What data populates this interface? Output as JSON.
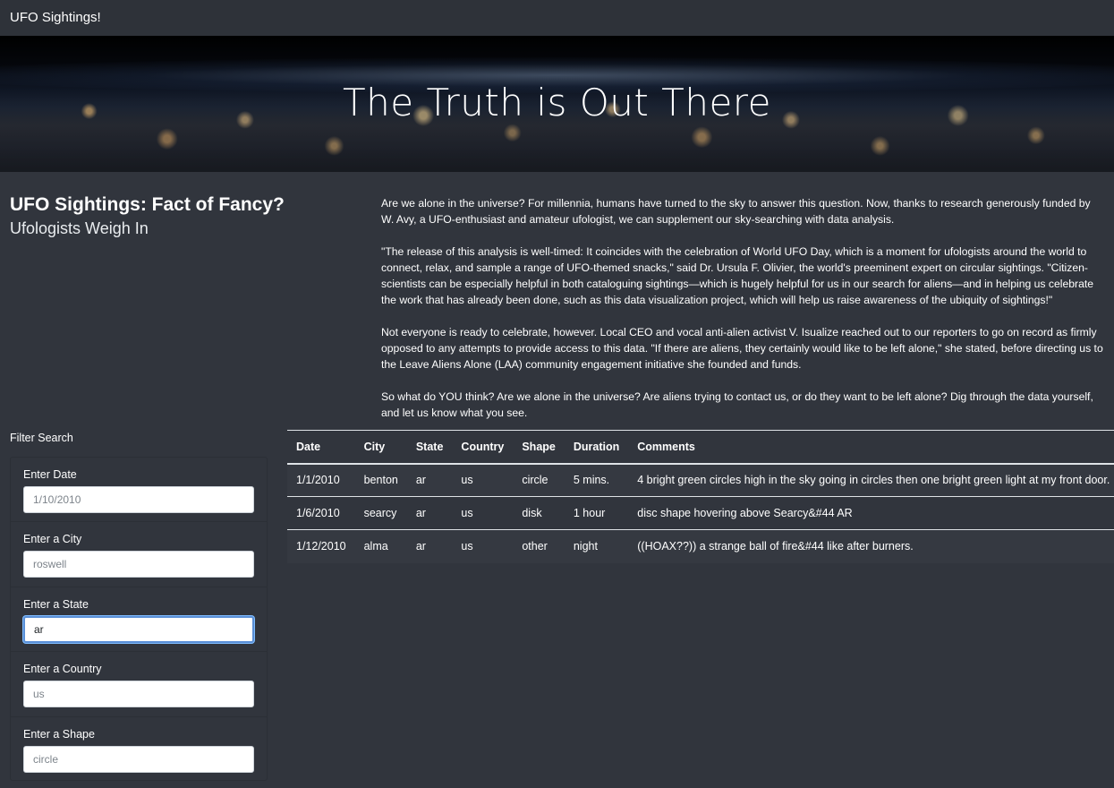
{
  "navbar": {
    "brand": "UFO Sightings!"
  },
  "hero": {
    "title": "The Truth is Out There"
  },
  "article": {
    "headline_strong": "UFO Sightings: Fact of Fancy?",
    "headline_muted": "Ufologists Weigh In",
    "paragraphs": [
      "Are we alone in the universe? For millennia, humans have turned to the sky to answer this question. Now, thanks to research generously funded by W. Avy, a UFO-enthusiast and amateur ufologist, we can supplement our sky-searching with data analysis.",
      "\"The release of this analysis is well-timed: It coincides with the celebration of World UFO Day, which is a moment for ufologists around the world to connect, relax, and sample a range of UFO-themed snacks,\" said Dr. Ursula F. Olivier, the world's preeminent expert on circular sightings. \"Citizen-scientists can be especially helpful in both cataloguing sightings—which is hugely helpful for us in our search for aliens—and in helping us celebrate the work that has already been done, such as this data visualization project, which will help us raise awareness of the ubiquity of sightings!\"",
      "Not everyone is ready to celebrate, however. Local CEO and vocal anti-alien activist V. Isualize reached out to our reporters to go on record as firmly opposed to any attempts to provide access to this data. \"If there are aliens, they certainly would like to be left alone,\" she stated, before directing us to the Leave Aliens Alone (LAA) community engagement initiative she founded and funds.",
      "So what do YOU think? Are we alone in the universe? Are aliens trying to contact us, or do they want to be left alone? Dig through the data yourself, and let us know what you see."
    ]
  },
  "filters": {
    "title": "Filter Search",
    "items": [
      {
        "label": "Enter Date",
        "placeholder": "1/10/2010",
        "value": ""
      },
      {
        "label": "Enter a City",
        "placeholder": "roswell",
        "value": ""
      },
      {
        "label": "Enter a State",
        "placeholder": "",
        "value": "ar"
      },
      {
        "label": "Enter a Country",
        "placeholder": "us",
        "value": ""
      },
      {
        "label": "Enter a Shape",
        "placeholder": "circle",
        "value": ""
      }
    ]
  },
  "table": {
    "headers": [
      "Date",
      "City",
      "State",
      "Country",
      "Shape",
      "Duration",
      "Comments"
    ],
    "rows": [
      [
        "1/1/2010",
        "benton",
        "ar",
        "us",
        "circle",
        "5 mins.",
        "4 bright green circles high in the sky going in circles then one bright green light at my front door."
      ],
      [
        "1/6/2010",
        "searcy",
        "ar",
        "us",
        "disk",
        "1 hour",
        "disc shape hovering above Searcy&#44 AR"
      ],
      [
        "1/12/2010",
        "alma",
        "ar",
        "us",
        "other",
        "night",
        "((HOAX??)) a strange ball of fire&#44 like after burners."
      ]
    ]
  },
  "colors": {
    "background": "#31353d",
    "focus_border": "#80bdff"
  }
}
